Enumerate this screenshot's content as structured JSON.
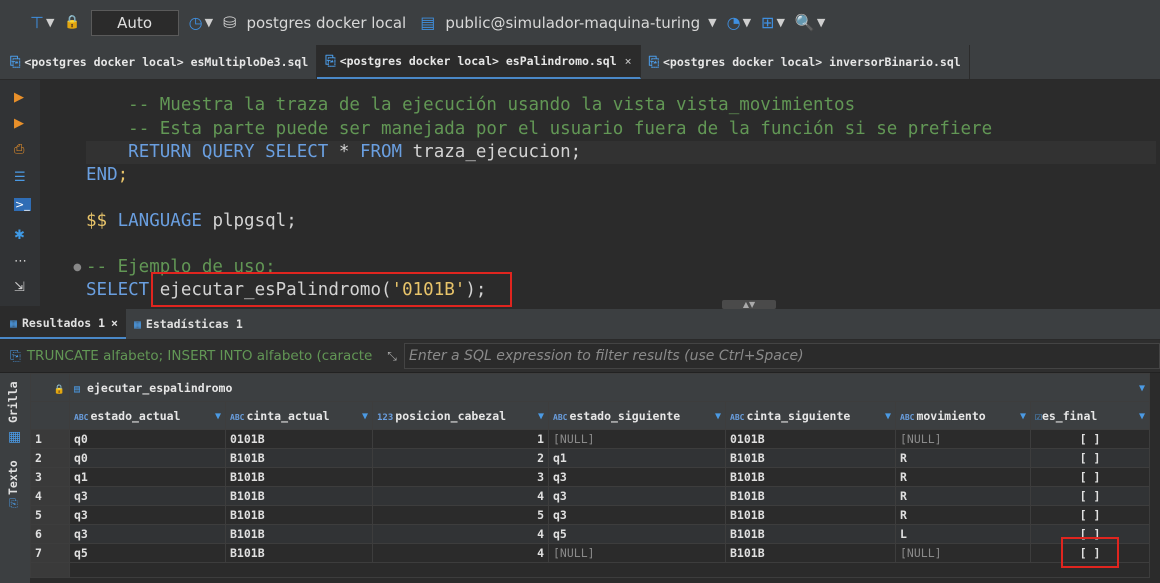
{
  "toolbar": {
    "transaction_mode": "Auto",
    "connection": "postgres docker local",
    "schema": "public@simulador-maquina-turing"
  },
  "tabs": [
    {
      "label": "<postgres docker local> esMultiploDe3.sql",
      "active": false
    },
    {
      "label": "<postgres docker local> esPalindromo.sql",
      "active": true,
      "close": "×"
    },
    {
      "label": "<postgres docker local> inversorBinario.sql",
      "active": false
    }
  ],
  "editor": {
    "comment1": "-- Muestra la traza de la ejecución usando la vista vista_movimientos",
    "comment2": "-- Esta parte puede ser manejada por el usuario fuera de la función si se prefiere",
    "return_kw": "RETURN QUERY SELECT",
    "return_star": " * ",
    "return_from": "FROM",
    "return_rest": " traza_ejecucion;",
    "end_kw": "END",
    "end_semi": ";",
    "dollar": "$$",
    "language_kw": " LANGUAGE",
    "language_rest": " plpgsql;",
    "comment3": "-- Ejemplo de uso:",
    "select_kw": "SELECT",
    "select_fn": " ejecutar_esPalindromo(",
    "select_str": "'0101B'",
    "select_end": ");"
  },
  "results": {
    "tab_results": "Resultados 1",
    "tab_results_close": "×",
    "tab_stats": "Estadísticas 1",
    "filter_history": "TRUNCATE alfabeto; INSERT INTO alfabeto (caracte",
    "filter_placeholder": "Enter a SQL expression to filter results (use Ctrl+Space)",
    "side_tab_grid": "Grilla",
    "side_tab_text": "Texto",
    "table_name": "ejecutar_espalindromo",
    "columns": [
      {
        "name": "estado_actual",
        "type": "ABC"
      },
      {
        "name": "cinta_actual",
        "type": "ABC"
      },
      {
        "name": "posicion_cabezal",
        "type": "123"
      },
      {
        "name": "estado_siguiente",
        "type": "ABC"
      },
      {
        "name": "cinta_siguiente",
        "type": "ABC"
      },
      {
        "name": "movimiento",
        "type": "ABC"
      },
      {
        "name": "es_final",
        "type": "checkbox"
      }
    ],
    "rows": [
      [
        "1",
        "q0",
        "0101B",
        "1",
        "[NULL]",
        "0101B",
        "[NULL]",
        "[ ]"
      ],
      [
        "2",
        "q0",
        "B101B",
        "2",
        "q1",
        "B101B",
        "R",
        "[ ]"
      ],
      [
        "3",
        "q1",
        "B101B",
        "3",
        "q3",
        "B101B",
        "R",
        "[ ]"
      ],
      [
        "4",
        "q3",
        "B101B",
        "4",
        "q3",
        "B101B",
        "R",
        "[ ]"
      ],
      [
        "5",
        "q3",
        "B101B",
        "5",
        "q3",
        "B101B",
        "R",
        "[ ]"
      ],
      [
        "6",
        "q3",
        "B101B",
        "4",
        "q5",
        "B101B",
        "L",
        "[ ]"
      ],
      [
        "7",
        "q5",
        "B101B",
        "4",
        "[NULL]",
        "B101B",
        "[NULL]",
        "[ ]"
      ]
    ]
  },
  "colors": {
    "accent": "#4b9ae4",
    "highlight_box": "#e0251f",
    "comment": "#629755",
    "keyword": "#6a9fe0",
    "string": "#e8c46a"
  }
}
